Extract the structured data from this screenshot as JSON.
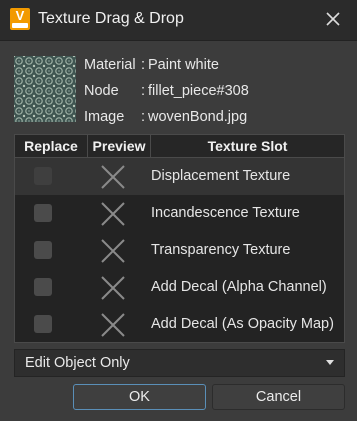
{
  "window": {
    "title": "Texture Drag & Drop",
    "app_icon": "V",
    "close_icon": "close-icon"
  },
  "info": {
    "material_label": "Material",
    "material_value": "Paint white",
    "node_label": "Node",
    "node_value": "fillet_piece#308",
    "image_label": "Image",
    "image_value": "wovenBond.jpg",
    "colon": ":"
  },
  "table": {
    "headers": [
      "Replace",
      "Preview",
      "Texture Slot"
    ],
    "rows": [
      {
        "slot": "Displacement Texture"
      },
      {
        "slot": "Incandescence Texture"
      },
      {
        "slot": "Transparency Texture"
      },
      {
        "slot": "Add Decal (Alpha Channel)"
      },
      {
        "slot": "Add Decal (As Opacity Map)"
      }
    ]
  },
  "dropdown": {
    "value": "Edit Object Only"
  },
  "buttons": {
    "ok": "OK",
    "cancel": "Cancel"
  },
  "colors": {
    "accent": "#5a8fb8",
    "app_icon": "#f29a00"
  }
}
